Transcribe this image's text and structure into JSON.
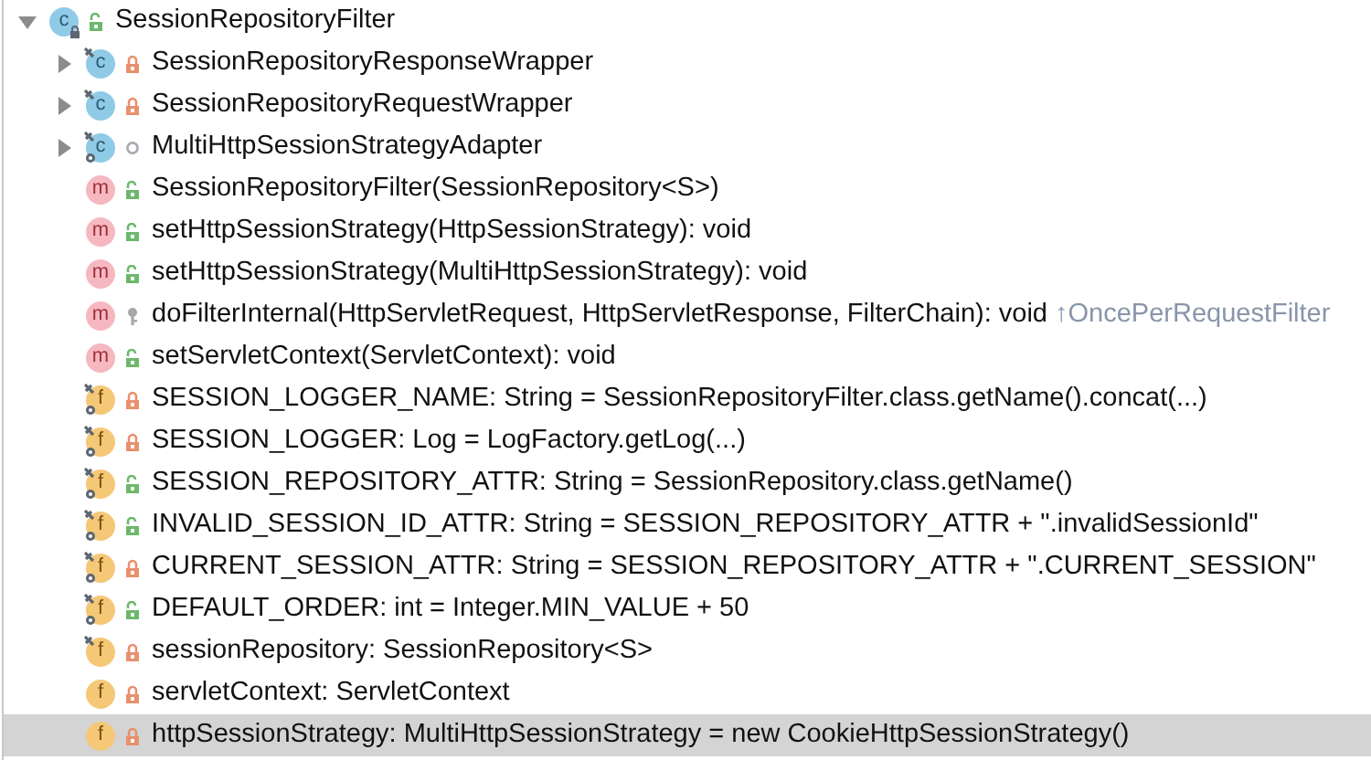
{
  "tree": {
    "badge": "c",
    "kind": "class",
    "access": {
      "kind": "public"
    },
    "expanded": true,
    "selected": false,
    "text": "SessionRepositoryFilter",
    "children": [
      {
        "kind": "class",
        "badge": "c",
        "access": {
          "kind": "private"
        },
        "final": true,
        "static": false,
        "expanded": false,
        "selected": false,
        "text": "SessionRepositoryResponseWrapper"
      },
      {
        "kind": "class",
        "badge": "c",
        "access": {
          "kind": "private"
        },
        "final": true,
        "static": false,
        "expanded": false,
        "selected": false,
        "text": "SessionRepositoryRequestWrapper"
      },
      {
        "kind": "class",
        "badge": "c",
        "access": {
          "kind": "package"
        },
        "final": true,
        "static": true,
        "expanded": false,
        "selected": false,
        "text": "MultiHttpSessionStrategyAdapter"
      },
      {
        "kind": "method",
        "badge": "m",
        "access": {
          "kind": "public"
        },
        "final": false,
        "static": false,
        "selected": false,
        "text": "SessionRepositoryFilter(SessionRepository<S>)"
      },
      {
        "kind": "method",
        "badge": "m",
        "access": {
          "kind": "public"
        },
        "final": false,
        "static": false,
        "selected": false,
        "text": "setHttpSessionStrategy(HttpSessionStrategy): void"
      },
      {
        "kind": "method",
        "badge": "m",
        "access": {
          "kind": "public"
        },
        "final": false,
        "static": false,
        "selected": false,
        "text": "setHttpSessionStrategy(MultiHttpSessionStrategy): void"
      },
      {
        "kind": "method",
        "badge": "m",
        "access": {
          "kind": "protected"
        },
        "final": false,
        "static": false,
        "selected": false,
        "text": "doFilterInternal(HttpServletRequest, HttpServletResponse, FilterChain): void",
        "inherited_from": "↑OncePerRequestFilter"
      },
      {
        "kind": "method",
        "badge": "m",
        "access": {
          "kind": "public"
        },
        "final": false,
        "static": false,
        "selected": false,
        "text": "setServletContext(ServletContext): void"
      },
      {
        "kind": "field",
        "badge": "f",
        "access": {
          "kind": "private"
        },
        "final": true,
        "static": true,
        "selected": false,
        "text": "SESSION_LOGGER_NAME: String = SessionRepositoryFilter.class.getName().concat(...)"
      },
      {
        "kind": "field",
        "badge": "f",
        "access": {
          "kind": "private"
        },
        "final": true,
        "static": true,
        "selected": false,
        "text": "SESSION_LOGGER: Log = LogFactory.getLog(...)"
      },
      {
        "kind": "field",
        "badge": "f",
        "access": {
          "kind": "public"
        },
        "final": true,
        "static": true,
        "selected": false,
        "text": "SESSION_REPOSITORY_ATTR: String = SessionRepository.class.getName()"
      },
      {
        "kind": "field",
        "badge": "f",
        "access": {
          "kind": "public"
        },
        "final": true,
        "static": true,
        "selected": false,
        "text": "INVALID_SESSION_ID_ATTR: String = SESSION_REPOSITORY_ATTR + \".invalidSessionId\""
      },
      {
        "kind": "field",
        "badge": "f",
        "access": {
          "kind": "private"
        },
        "final": true,
        "static": true,
        "selected": false,
        "text": "CURRENT_SESSION_ATTR: String = SESSION_REPOSITORY_ATTR + \".CURRENT_SESSION\""
      },
      {
        "kind": "field",
        "badge": "f",
        "access": {
          "kind": "public"
        },
        "final": true,
        "static": true,
        "selected": false,
        "text": "DEFAULT_ORDER: int = Integer.MIN_VALUE + 50"
      },
      {
        "kind": "field",
        "badge": "f",
        "access": {
          "kind": "private"
        },
        "final": true,
        "static": false,
        "selected": false,
        "text": "sessionRepository: SessionRepository<S>"
      },
      {
        "kind": "field",
        "badge": "f",
        "access": {
          "kind": "private"
        },
        "final": false,
        "static": false,
        "selected": false,
        "text": "servletContext: ServletContext"
      },
      {
        "kind": "field",
        "badge": "f",
        "access": {
          "kind": "private"
        },
        "final": false,
        "static": false,
        "selected": true,
        "text": "httpSessionStrategy: MultiHttpSessionStrategy = new CookieHttpSessionStrategy()"
      }
    ]
  }
}
